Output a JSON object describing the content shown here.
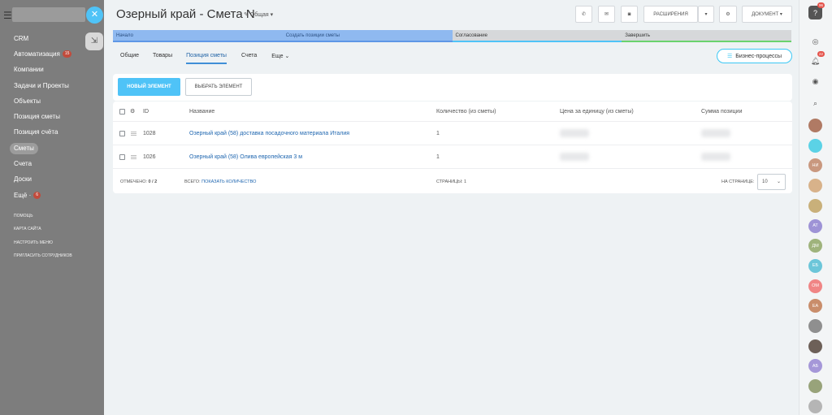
{
  "sidebar": {
    "items": [
      {
        "label": "CRM"
      },
      {
        "label": "Автоматизация",
        "badge": "15"
      },
      {
        "label": "Компании"
      },
      {
        "label": "Задачи и Проекты"
      },
      {
        "label": "Объекты"
      },
      {
        "label": "Позиция сметы"
      },
      {
        "label": "Позиция счёта"
      },
      {
        "label": "Сметы",
        "active": true
      },
      {
        "label": "Счета"
      },
      {
        "label": "Доски"
      },
      {
        "label": "Ещё ·",
        "badge": "6"
      }
    ],
    "footer": [
      "ПОМОЩЬ",
      "КАРТА САЙТА",
      "НАСТРОИТЬ МЕНЮ",
      "ПРИГЛАСИТЬ СОТРУДНИКОВ"
    ]
  },
  "header": {
    "title": "Озерный край - Смета N",
    "category": "Общая",
    "extensions_label": "РАСШИРЕНИЯ",
    "document_label": "ДОКУМЕНТ"
  },
  "stages": [
    {
      "label": "Начало"
    },
    {
      "label": "Создать позиции сметы"
    },
    {
      "label": "Согласование"
    },
    {
      "label": "Завершить"
    }
  ],
  "tabs": [
    {
      "label": "Общие"
    },
    {
      "label": "Товары"
    },
    {
      "label": "Позиция сметы",
      "active": true
    },
    {
      "label": "Счета"
    },
    {
      "label": "Еще"
    }
  ],
  "business_processes_label": "Бизнес-процессы",
  "toolbar": {
    "new_label": "НОВЫЙ ЭЛЕМЕНТ",
    "pick_label": "ВЫБРАТЬ ЭЛЕМЕНТ"
  },
  "grid": {
    "columns": {
      "id": "ID",
      "name": "Название",
      "qty": "Количество (из сметы)",
      "price": "Цена за единицу (из сметы)",
      "sum": "Сумма позиции"
    },
    "rows": [
      {
        "id": "1028",
        "name": "Озерный край (58) доставка посадочного материала Италия",
        "qty": "1"
      },
      {
        "id": "1026",
        "name": "Озерный край (58) Олива европейская 3 м",
        "qty": "1"
      }
    ],
    "footer": {
      "selected_label": "ОТМЕЧЕНО:",
      "selected_value": "0 / 2",
      "total_label": "ВСЕГО:",
      "show_count_label": "ПОКАЗАТЬ КОЛИЧЕСТВО",
      "pages_label": "СТРАНИЦЫ:",
      "pages_value": "1",
      "per_page_label": "НА СТРАНИЦЕ:",
      "per_page_value": "10"
    }
  },
  "rail": {
    "notifications_badge": "22",
    "help_badge": "96",
    "avatars": [
      {
        "initials": "",
        "color": "#b07a64"
      },
      {
        "initials": "",
        "color": "#5bd2e6"
      },
      {
        "initials": "НИ",
        "color": "#c9987f"
      },
      {
        "initials": "",
        "color": "#d8b28a"
      },
      {
        "initials": "",
        "color": "#c9b07a"
      },
      {
        "initials": "АТ",
        "color": "#9e93d6"
      },
      {
        "initials": "ДМ",
        "color": "#9fb37c"
      },
      {
        "initials": "ЕБ",
        "color": "#6cc6d9"
      },
      {
        "initials": "ОМ",
        "color": "#f08585"
      },
      {
        "initials": "ЕА",
        "color": "#c98d6b"
      },
      {
        "initials": "",
        "color": "#8f8f8f"
      },
      {
        "initials": "",
        "color": "#6d6058"
      },
      {
        "initials": "АБ",
        "color": "#a597d8"
      },
      {
        "initials": "",
        "color": "#98a37a"
      },
      {
        "initials": "",
        "color": "#b5b5b5"
      }
    ]
  },
  "colors": {
    "accent": "#4fc3f7",
    "stage_active": "#8fb9f0",
    "link": "#2067b0",
    "sidebar_bg": "#7d7d7d"
  }
}
